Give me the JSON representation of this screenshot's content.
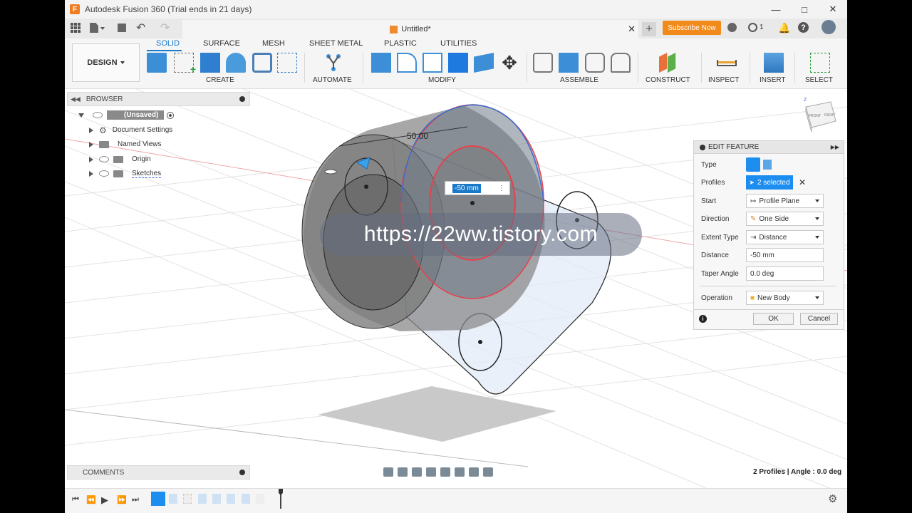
{
  "window": {
    "title": "Autodesk Fusion 360 (Trial ends in 21 days)",
    "logo_letter": "F"
  },
  "tabs": {
    "document_name": "Untitled*",
    "subscribe_label": "Subscribe Now",
    "jobs_count": "1"
  },
  "ribbon": {
    "workspace_label": "DESIGN",
    "tabs": [
      "SOLID",
      "SURFACE",
      "MESH",
      "SHEET METAL",
      "PLASTIC",
      "UTILITIES"
    ],
    "active_tab": "SOLID",
    "groups": [
      "CREATE",
      "AUTOMATE",
      "MODIFY",
      "ASSEMBLE",
      "CONSTRUCT",
      "INSPECT",
      "INSERT",
      "SELECT"
    ]
  },
  "browser": {
    "title": "BROWSER",
    "root_label": "(Unsaved)",
    "items": [
      "Document Settings",
      "Named Views",
      "Origin",
      "Sketches"
    ]
  },
  "viewport": {
    "dimension_label": "50.00",
    "distance_input_value": "-50 mm",
    "watermark_text": "https://22ww.tistory.com",
    "viewcube_labels": [
      "FRONT",
      "RIGHT",
      "Z"
    ]
  },
  "edit_feature": {
    "title": "EDIT FEATURE",
    "rows": {
      "type_label": "Type",
      "profiles_label": "Profiles",
      "profiles_value": "2 selected",
      "start_label": "Start",
      "start_value": "Profile Plane",
      "direction_label": "Direction",
      "direction_value": "One Side",
      "extent_label": "Extent Type",
      "extent_value": "Distance",
      "distance_label": "Distance",
      "distance_value": "-50 mm",
      "taper_label": "Taper Angle",
      "taper_value": "0.0 deg",
      "operation_label": "Operation",
      "operation_value": "New Body"
    },
    "ok_label": "OK",
    "cancel_label": "Cancel"
  },
  "comments": {
    "title": "COMMENTS"
  },
  "status": {
    "text": "2 Profiles | Angle : 0.0 deg"
  },
  "colors": {
    "accent_blue": "#1a79c8",
    "subscribe_orange": "#f28a1b",
    "profile_selected_blue": "#1d8ef0",
    "selection_red": "#e8414d"
  }
}
